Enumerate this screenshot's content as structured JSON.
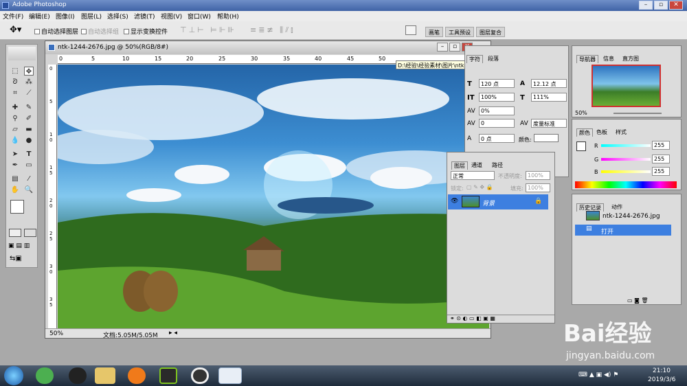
{
  "app": {
    "title": "Adobe Photoshop"
  },
  "menu": [
    "文件(F)",
    "编辑(E)",
    "图像(I)",
    "图层(L)",
    "选择(S)",
    "滤镜(T)",
    "视图(V)",
    "窗口(W)",
    "帮助(H)"
  ],
  "options": {
    "auto_select_layer": "自动选择图层",
    "auto_select_group": "自动选择组",
    "show_transform": "显示变换控件"
  },
  "palette_tabs": [
    "画笔",
    "工具预设",
    "图层复合"
  ],
  "document": {
    "title": "ntk-1244-2676.jpg @ 50%(RGB/8#)",
    "tooltip": "D:\\经验\\经验素材\\图片\\ntk-1244-2676.jpg @ 50%(RGB/8#)",
    "zoom": "50%",
    "doc_size": "文档:5.05M/5.05M"
  },
  "ruler": {
    "h": [
      "0",
      "5",
      "10",
      "15",
      "20",
      "25",
      "30",
      "35",
      "40",
      "45",
      "50"
    ],
    "v": [
      "0",
      "5",
      "1 0",
      "1 5",
      "2 0",
      "2 5",
      "3 0",
      "3 5"
    ]
  },
  "character": {
    "tab1": "字符",
    "tab2": "段落",
    "size": "120 点",
    "leading": "12.12 点",
    "vscale": "100%",
    "hscale": "111%",
    "tracking": "0%",
    "kerning": "0",
    "kern_mode": "度量标准",
    "baseline": "0 点",
    "color_label": "颜色:"
  },
  "layers": {
    "tabs": [
      "图层",
      "通道",
      "路径"
    ],
    "blend": "正常",
    "opacity_label": "不透明度:",
    "opacity": "100%",
    "lock_label": "锁定:",
    "fill_label": "填充:",
    "fill": "100%",
    "layer_name": "背景"
  },
  "navigator": {
    "tabs": [
      "导航器",
      "信息",
      "直方图"
    ],
    "zoom": "50%"
  },
  "color": {
    "tabs": [
      "颜色",
      "色板",
      "样式"
    ],
    "r_label": "R",
    "g_label": "G",
    "b_label": "B",
    "r": "255",
    "g": "255",
    "b": "255"
  },
  "history": {
    "tabs": [
      "历史记录",
      "动作"
    ],
    "snapshot": "ntk-1244-2676.jpg",
    "step": "打开"
  },
  "taskbar": {
    "time": "21:10",
    "date": "2019/3/6"
  },
  "watermark": {
    "brand": "Bai经验",
    "url": "jingyan.baidu.com"
  },
  "colors": {
    "highlight": "#3d7fe0",
    "titlebar": "#3f63a6"
  }
}
